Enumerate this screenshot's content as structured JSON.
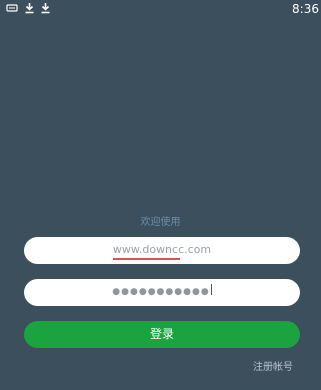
{
  "status_bar": {
    "time": "8:36",
    "icons": [
      "notification-icon",
      "download-icon",
      "download-icon"
    ]
  },
  "login": {
    "welcome_text": "欢迎使用",
    "username_value": "www.downcc.com",
    "password_mask": "●●●●●●●●●●●",
    "login_label": "登录",
    "register_label": "注册帐号"
  },
  "colors": {
    "background": "#3b4f5d",
    "button": "#1aa33f",
    "input": "#ffffff",
    "welcome_text": "#6a8fa3"
  }
}
